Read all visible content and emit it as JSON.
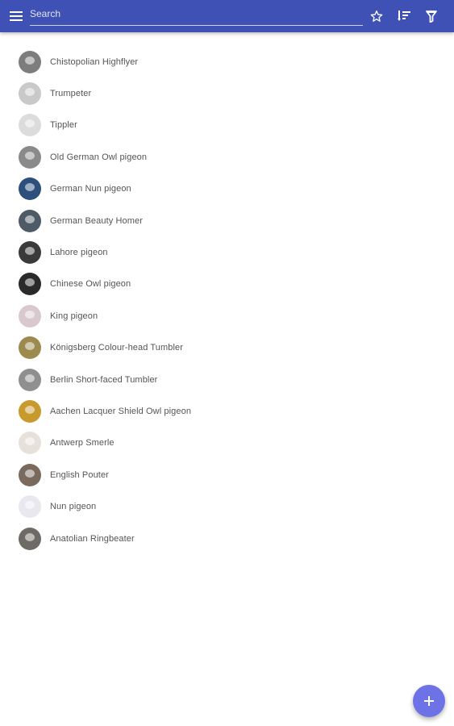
{
  "toolbar": {
    "background": "#3f51b5",
    "menu_icon": "menu-icon",
    "search": {
      "placeholder": "Search",
      "value": ""
    },
    "favorites_icon": "star-outline-icon",
    "sort_icon": "sort-icon",
    "filter_icon": "filter-icon"
  },
  "breeds": [
    {
      "name": "Chistopolian Highflyer",
      "avatar_color": "#7d7d7d"
    },
    {
      "name": "Trumpeter",
      "avatar_color": "#c9c9c9"
    },
    {
      "name": "Tippler",
      "avatar_color": "#dcdcdc"
    },
    {
      "name": "Old German Owl pigeon",
      "avatar_color": "#8a8a8a"
    },
    {
      "name": "German Nun pigeon",
      "avatar_color": "#2c4f7c"
    },
    {
      "name": "German Beauty Homer",
      "avatar_color": "#4e5a66"
    },
    {
      "name": "Lahore pigeon",
      "avatar_color": "#3a3a3a"
    },
    {
      "name": "Chinese Owl pigeon",
      "avatar_color": "#2a2a2a"
    },
    {
      "name": "King pigeon",
      "avatar_color": "#d9c9cf"
    },
    {
      "name": "Königsberg Colour-head Tumbler",
      "avatar_color": "#9c8a4e"
    },
    {
      "name": "Berlin Short-faced Tumbler",
      "avatar_color": "#8f8f8f"
    },
    {
      "name": "Aachen Lacquer Shield Owl pigeon",
      "avatar_color": "#c89a2e"
    },
    {
      "name": "Antwerp Smerle",
      "avatar_color": "#e6e1da"
    },
    {
      "name": "English Pouter",
      "avatar_color": "#7a6a5e"
    },
    {
      "name": "Nun pigeon",
      "avatar_color": "#e8e8ee"
    },
    {
      "name": "Anatolian Ringbeater",
      "avatar_color": "#6e6a66"
    }
  ],
  "fab": {
    "icon": "plus-icon",
    "color": "#6d72e6"
  }
}
